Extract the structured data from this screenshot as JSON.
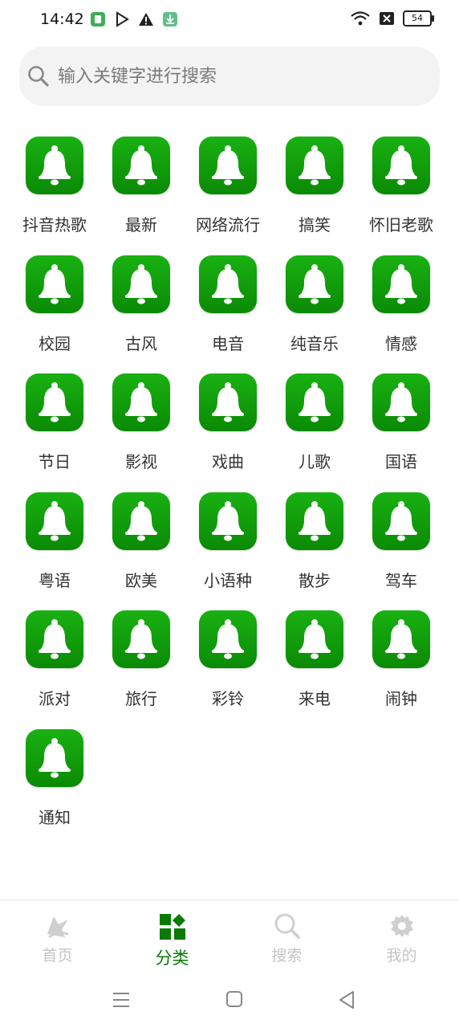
{
  "status": {
    "time": "14:42",
    "battery": "54"
  },
  "search": {
    "placeholder": "输入关键字进行搜索"
  },
  "categories": [
    {
      "label": "抖音热歌"
    },
    {
      "label": "最新"
    },
    {
      "label": "网络流行"
    },
    {
      "label": "搞笑"
    },
    {
      "label": "怀旧老歌"
    },
    {
      "label": "校园"
    },
    {
      "label": "古风"
    },
    {
      "label": "电音"
    },
    {
      "label": "纯音乐"
    },
    {
      "label": "情感"
    },
    {
      "label": "节日"
    },
    {
      "label": "影视"
    },
    {
      "label": "戏曲"
    },
    {
      "label": "儿歌"
    },
    {
      "label": "国语"
    },
    {
      "label": "粤语"
    },
    {
      "label": "欧美"
    },
    {
      "label": "小语种"
    },
    {
      "label": "散步"
    },
    {
      "label": "驾车"
    },
    {
      "label": "派对"
    },
    {
      "label": "旅行"
    },
    {
      "label": "彩铃"
    },
    {
      "label": "来电"
    },
    {
      "label": "闹钟"
    },
    {
      "label": "通知"
    }
  ],
  "nav": {
    "home": "首页",
    "category": "分类",
    "search": "搜索",
    "mine": "我的"
  },
  "colors": {
    "accent": "#0a7a05",
    "icon_green": "#14a50e",
    "inactive": "#c4c4c4"
  }
}
